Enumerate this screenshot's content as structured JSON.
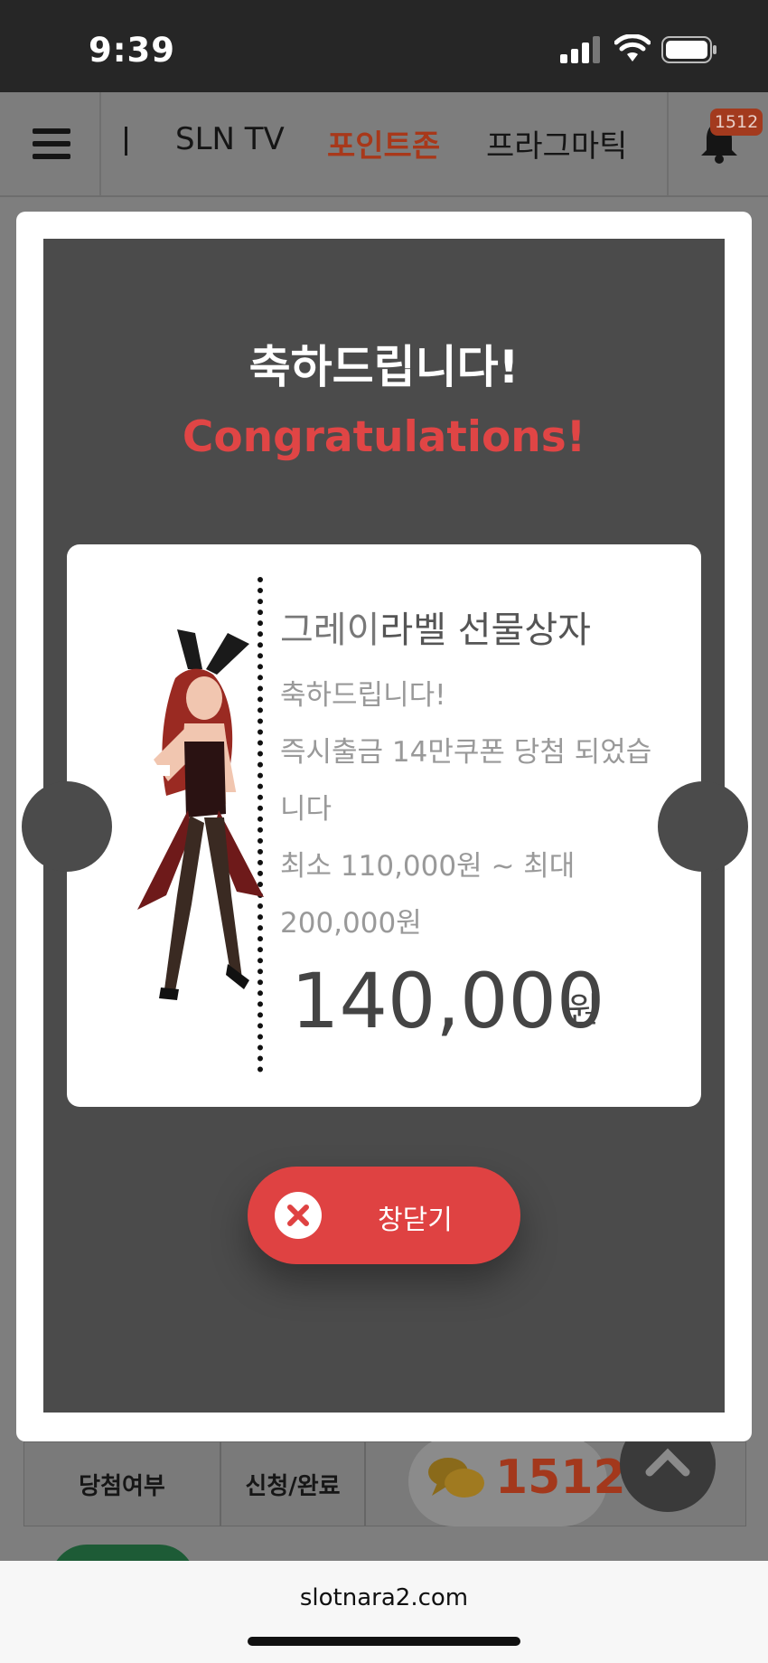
{
  "status_bar": {
    "time": "9:39"
  },
  "nav": {
    "items": [
      {
        "label": "SLN TV"
      },
      {
        "label": "포인트존"
      },
      {
        "label": "프라그마틱"
      }
    ],
    "notification_badge": "1512"
  },
  "modal": {
    "title_ko": "축하드립니다!",
    "title_en": "Congratulations!",
    "ticket": {
      "title_highlight": "그레이",
      "title_rest": "라벨 선물상자",
      "lines": [
        "축하드립니다!",
        "즉시출금 14만쿠폰 당첨 되었습니다",
        "최소 110,000원 ~ 최대 200,000원"
      ],
      "amount": "140,000",
      "amount_unit": "원"
    },
    "close_label": "창닫기"
  },
  "background_table": {
    "headers": [
      "당첨여부",
      "신청/완료"
    ],
    "chat_count": "1512"
  },
  "browser": {
    "url": "slotnara2.com"
  },
  "colors": {
    "accent_red": "#e04545",
    "button_red": "#df4242",
    "nav_active": "#a8381a"
  }
}
